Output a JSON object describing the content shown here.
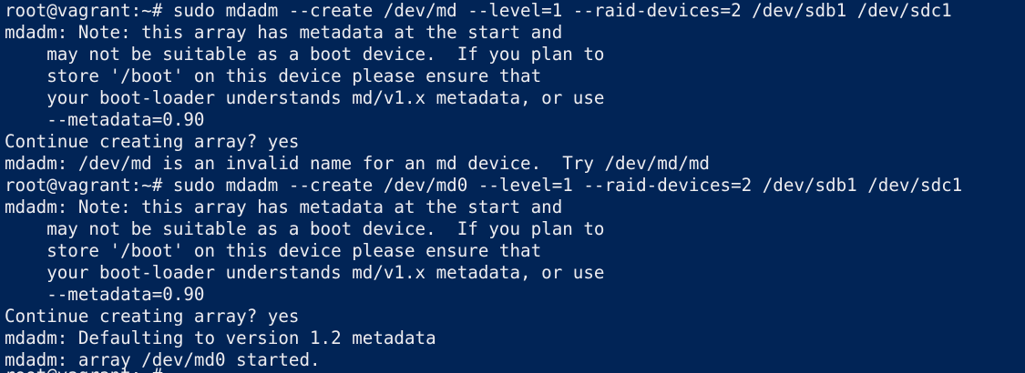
{
  "terminal": {
    "background": "#012456",
    "foreground": "#eeedf0",
    "lines": [
      "root@vagrant:~# sudo mdadm --create /dev/md --level=1 --raid-devices=2 /dev/sdb1 /dev/sdc1",
      "mdadm: Note: this array has metadata at the start and",
      "    may not be suitable as a boot device.  If you plan to",
      "    store '/boot' on this device please ensure that",
      "    your boot-loader understands md/v1.x metadata, or use",
      "    --metadata=0.90",
      "Continue creating array? yes",
      "mdadm: /dev/md is an invalid name for an md device.  Try /dev/md/md",
      "root@vagrant:~# sudo mdadm --create /dev/md0 --level=1 --raid-devices=2 /dev/sdb1 /dev/sdc1",
      "mdadm: Note: this array has metadata at the start and",
      "    may not be suitable as a boot device.  If you plan to",
      "    store '/boot' on this device please ensure that",
      "    your boot-loader understands md/v1.x metadata, or use",
      "    --metadata=0.90",
      "Continue creating array? yes",
      "mdadm: Defaulting to version 1.2 metadata",
      "mdadm: array /dev/md0 started."
    ],
    "partial_line": "root@vagrant:~#"
  }
}
